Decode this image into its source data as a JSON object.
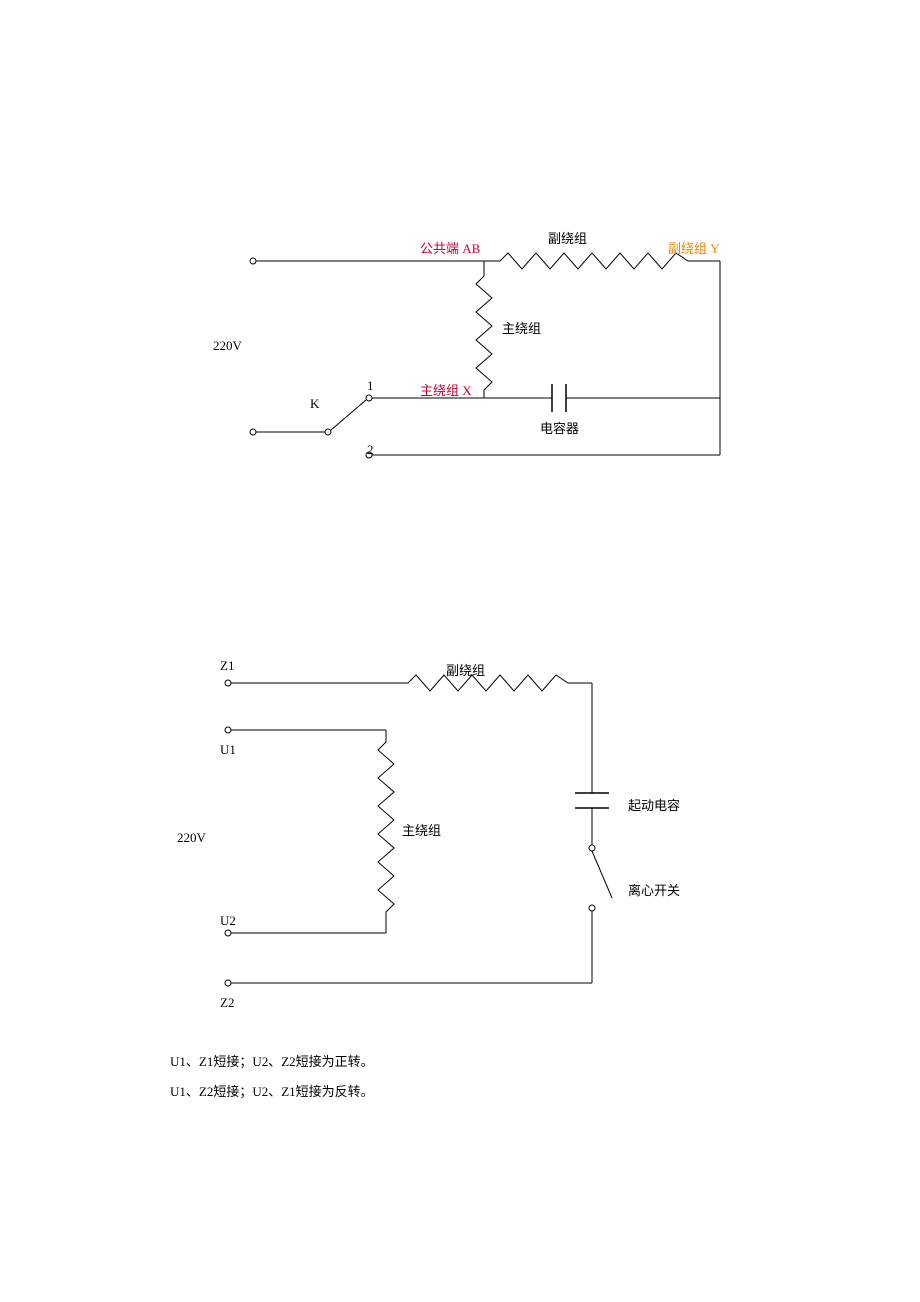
{
  "circuit1": {
    "voltage": "220V",
    "commonTerminal": "公共端 AB",
    "auxWinding": "副绕组",
    "auxWindingY": "副绕组 Y",
    "mainWinding": "主绕组",
    "mainWindingX": "主绕组 X",
    "capacitor": "电容器",
    "switchK": "K",
    "pos1": "1",
    "pos2": "2"
  },
  "circuit2": {
    "voltage": "220V",
    "z1": "Z1",
    "z2": "Z2",
    "u1": "U1",
    "u2": "U2",
    "auxWinding": "副绕组",
    "mainWinding": "主绕组",
    "startCapacitor": "起动电容",
    "centrifugalSwitch": "离心开关"
  },
  "notes": {
    "line1": "U1、Z1短接；U2、Z2短接为正转。",
    "line2": "U1、Z2短接；U2、Z1短接为反转。"
  }
}
